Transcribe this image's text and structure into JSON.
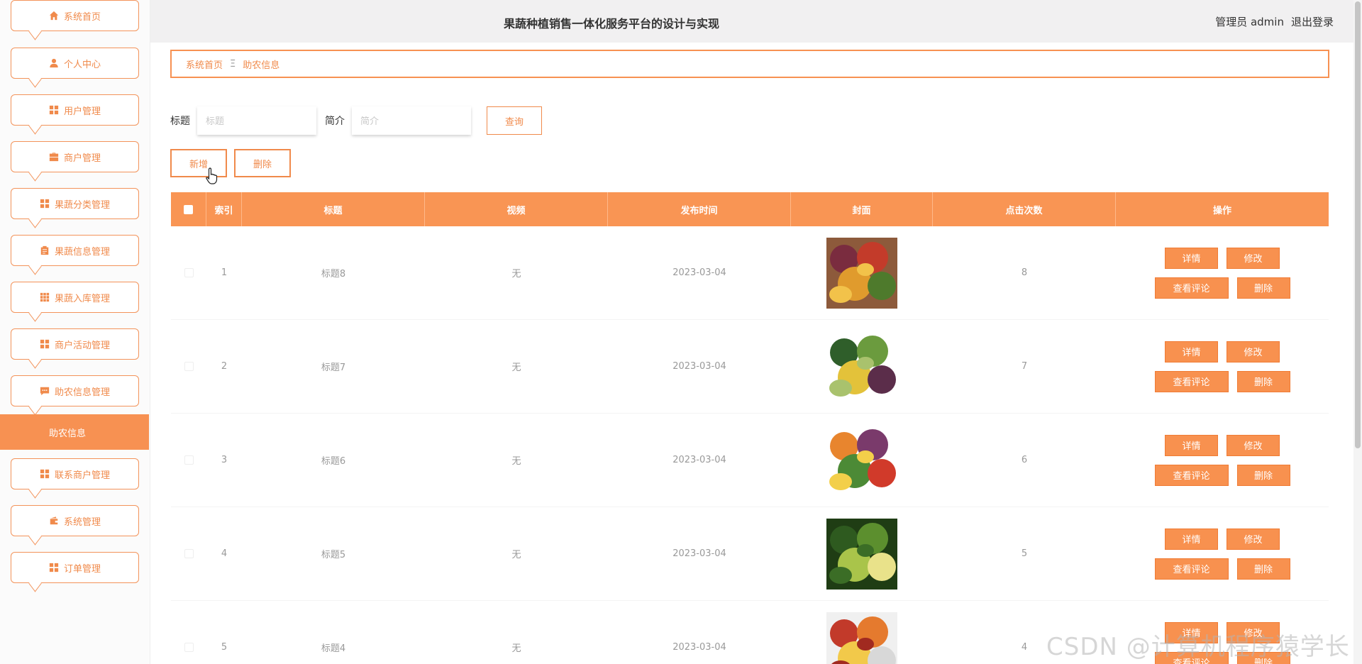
{
  "header": {
    "title": "果蔬种植销售一体化服务平台的设计与实现",
    "user": "管理员 admin",
    "logout": "退出登录"
  },
  "sidebar": {
    "items": [
      {
        "label": "系统首页",
        "icon": "home-icon"
      },
      {
        "label": "个人中心",
        "icon": "user-icon"
      },
      {
        "label": "用户管理",
        "icon": "grid-icon"
      },
      {
        "label": "商户管理",
        "icon": "briefcase-icon"
      },
      {
        "label": "果蔬分类管理",
        "icon": "grid-icon"
      },
      {
        "label": "果蔬信息管理",
        "icon": "clipboard-icon"
      },
      {
        "label": "果蔬入库管理",
        "icon": "apps-icon"
      },
      {
        "label": "商户活动管理",
        "icon": "grid-icon"
      },
      {
        "label": "助农信息管理",
        "icon": "chat-icon"
      },
      {
        "label": "联系商户管理",
        "icon": "grid-icon"
      },
      {
        "label": "系统管理",
        "icon": "wallet-icon"
      },
      {
        "label": "订单管理",
        "icon": "grid-icon"
      }
    ],
    "active_sub": "助农信息"
  },
  "breadcrumb": {
    "home": "系统首页",
    "separator": "Ξ",
    "current": "助农信息"
  },
  "search": {
    "title_label": "标题",
    "title_placeholder": "标题",
    "intro_label": "简介",
    "intro_placeholder": "简介",
    "query_button": "查询"
  },
  "actions": {
    "add": "新增",
    "delete": "删除"
  },
  "table": {
    "columns": [
      "索引",
      "标题",
      "视频",
      "发布时间",
      "封面",
      "点击次数",
      "操作"
    ],
    "rows": [
      {
        "index": "1",
        "title": "标题8",
        "video": "无",
        "date": "2023-03-04",
        "clicks": "8"
      },
      {
        "index": "2",
        "title": "标题7",
        "video": "无",
        "date": "2023-03-04",
        "clicks": "7"
      },
      {
        "index": "3",
        "title": "标题6",
        "video": "无",
        "date": "2023-03-04",
        "clicks": "6"
      },
      {
        "index": "4",
        "title": "标题5",
        "video": "无",
        "date": "2023-03-04",
        "clicks": "5"
      },
      {
        "index": "5",
        "title": "标题4",
        "video": "无",
        "date": "2023-03-04",
        "clicks": "4"
      }
    ],
    "ops": {
      "detail": "详情",
      "edit": "修改",
      "comments": "查看评论",
      "delete": "删除"
    }
  },
  "watermark": "CSDN @计算机程序猿学长",
  "colors": {
    "accent": "#f79152",
    "accent_text": "#f08a4b"
  }
}
